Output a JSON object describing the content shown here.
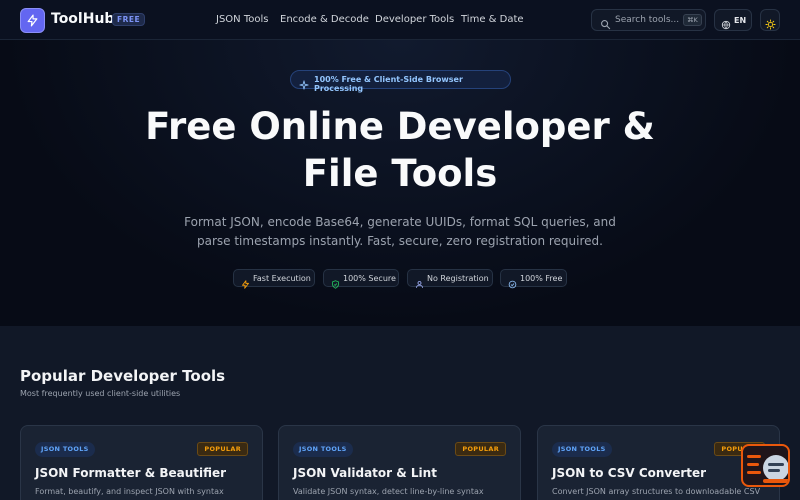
{
  "header": {
    "brand": "ToolHub",
    "badge": "FREE",
    "nav": [
      "JSON Tools",
      "Encode & Decode",
      "Developer Tools",
      "Time & Date"
    ],
    "search_placeholder": "Search tools...",
    "search_shortcut": "⌘K",
    "language": "EN"
  },
  "hero": {
    "pill": "100% Free & Client-Side Browser Processing",
    "title_line1": "Free Online Developer &",
    "title_line2": "File Tools",
    "subtitle_line1": "Format JSON, encode Base64, generate UUIDs, format SQL queries, and",
    "subtitle_line2": "parse timestamps instantly. Fast, secure, zero registration required.",
    "features": [
      "Fast Execution",
      "100% Secure",
      "No Registration",
      "100% Free"
    ]
  },
  "tools": {
    "title": "Popular Developer Tools",
    "subtitle": "Most frequently used client-side utilities",
    "cards": [
      {
        "category": "JSON TOOLS",
        "badge": "POPULAR",
        "title": "JSON Formatter & Beautifier",
        "desc": "Format, beautify, and inspect JSON with syntax"
      },
      {
        "category": "JSON TOOLS",
        "badge": "POPULAR",
        "title": "JSON Validator & Lint",
        "desc": "Validate JSON syntax, detect line-by-line syntax errors,"
      },
      {
        "category": "JSON TOOLS",
        "badge": "POPULAR",
        "title": "JSON to CSV Converter",
        "desc": "Convert JSON array structures to downloadable CSV"
      }
    ]
  },
  "colors": {
    "accent": "#6366f1",
    "popular": "#f59e0b",
    "category": "#60a5fa",
    "float_border": "#ea580c"
  }
}
